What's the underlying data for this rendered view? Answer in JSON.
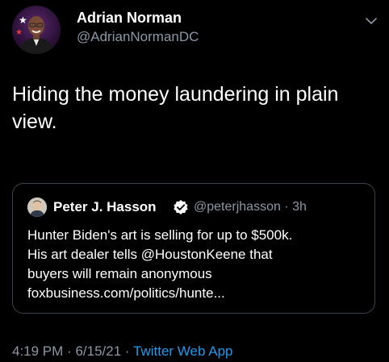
{
  "author": {
    "name": "Adrian Norman",
    "handle": "@AdrianNormanDC"
  },
  "tweet": {
    "text": "Hiding the money laundering in plain view."
  },
  "quoted_tweet": {
    "author_name": "Peter J. Hasson",
    "handle": "@peterjhasson",
    "separator": "·",
    "age": "3h",
    "lines": [
      "Hunter Biden's art is selling for up to $500k.",
      "His art dealer tells @HoustonKeene that",
      "buyers will remain anonymous",
      "foxbusiness.com/politics/hunte..."
    ]
  },
  "meta": {
    "time": "4:19 PM",
    "sep1": "·",
    "date": "6/15/21",
    "sep2": "·",
    "app": "Twitter Web App"
  },
  "icons": {
    "caret": "chevron-down-icon",
    "verified": "verified-badge-icon"
  },
  "colors": {
    "background": "#000000",
    "text": "#ffffff",
    "secondary": "#8b98a5",
    "link": "#1d9bf0",
    "border": "#38444d",
    "verified": "#1d9bf0"
  }
}
